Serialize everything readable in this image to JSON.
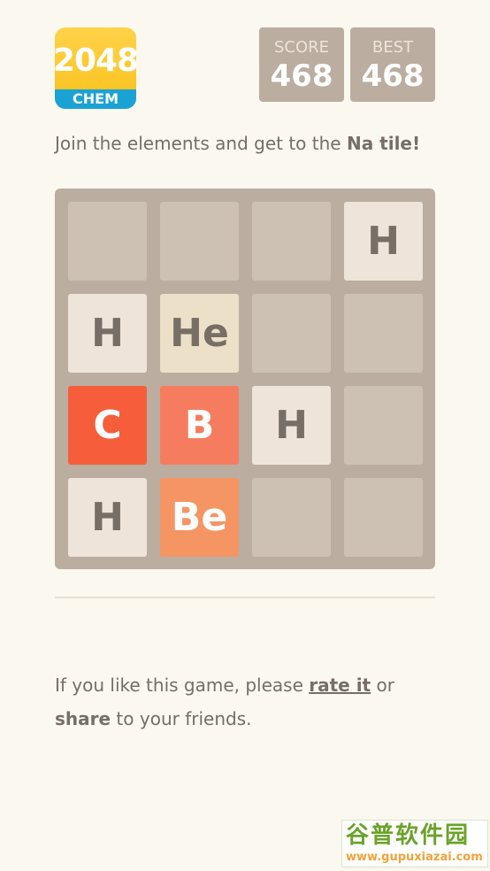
{
  "logo": {
    "number": "2048",
    "subtitle": "CHEM"
  },
  "score": {
    "label": "SCORE",
    "value": "468"
  },
  "best": {
    "label": "BEST",
    "value": "468"
  },
  "intro": {
    "prefix": "Join the elements and get to the ",
    "goal": "Na tile!"
  },
  "board": {
    "rows": [
      [
        "",
        "",
        "",
        "H"
      ],
      [
        "H",
        "He",
        "",
        ""
      ],
      [
        "C",
        "B",
        "H",
        ""
      ],
      [
        "H",
        "Be",
        "",
        ""
      ]
    ],
    "tile_styles": {
      "H": {
        "bg": "#eee4da",
        "fg": "#776e65"
      },
      "He": {
        "bg": "#ede0c8",
        "fg": "#776e65"
      },
      "Be": {
        "bg": "#f59563",
        "fg": "#ffffff"
      },
      "B": {
        "bg": "#f67c5f",
        "fg": "#ffffff"
      },
      "C": {
        "bg": "#f65e3b",
        "fg": "#ffffff"
      }
    },
    "empty_color": "#cdc1b4"
  },
  "footer": {
    "line1_prefix": "If you like this game, please ",
    "rate_link": "rate it",
    "line1_suffix": " or",
    "share_link": "share",
    "line2_suffix": " to your friends."
  },
  "watermark": {
    "name": "谷普软件园",
    "url": "www.gupuxiazai.com"
  }
}
